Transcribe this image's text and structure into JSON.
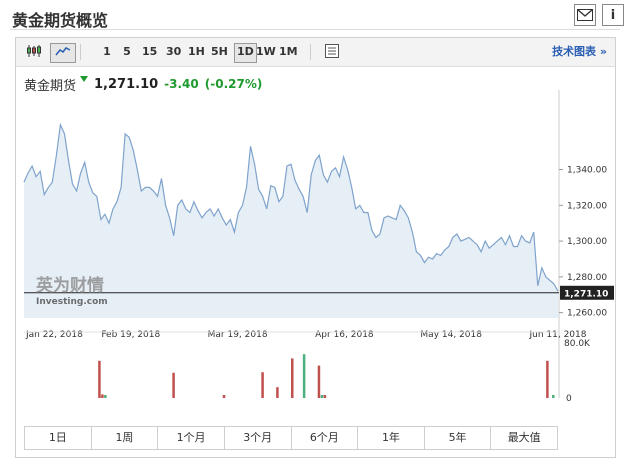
{
  "header": {
    "title": "黄金期货概览",
    "icons": [
      "mail-icon",
      "info-icon"
    ]
  },
  "toolbar": {
    "intervals": [
      "1",
      "5",
      "15",
      "30",
      "1H",
      "5H",
      "1D",
      "1W",
      "1M"
    ],
    "active_interval": "1D",
    "link_label": "技术图表 »"
  },
  "quote": {
    "name": "黄金期货",
    "price": "1,271.10",
    "change": "-3.40",
    "change_pct": "(-0.27%)",
    "direction": "down",
    "down_color": "#1f9a2f"
  },
  "watermark": {
    "line1": "英为财情",
    "line2": "Investing.com"
  },
  "chart_data": {
    "type": "area",
    "y_ticks": [
      "1,340.00",
      "1,320.00",
      "1,300.00",
      "1,280.00",
      "1,260.00"
    ],
    "y_tick_values": [
      1340,
      1320,
      1300,
      1280,
      1260
    ],
    "ylim": [
      1257,
      1380
    ],
    "x_ticks": [
      "Jan 22, 2018",
      "Feb 19, 2018",
      "Mar 19, 2018",
      "Apr 16, 2018",
      "May 14, 2018",
      "Jun 11, 2018"
    ],
    "x_tick_index": [
      0,
      20,
      40,
      60,
      80,
      100
    ],
    "current_label": "1,271.10",
    "current_value": 1271.1,
    "line_color": "#7fa3cc",
    "fill_color": "#e6eef6",
    "values": [
      1333,
      1338,
      1342,
      1336,
      1339,
      1326,
      1330,
      1333,
      1348,
      1365,
      1360,
      1345,
      1332,
      1328,
      1338,
      1344,
      1333,
      1327,
      1325,
      1312,
      1315,
      1310,
      1318,
      1322,
      1330,
      1360,
      1358,
      1351,
      1340,
      1328,
      1330,
      1330,
      1328,
      1325,
      1335,
      1320,
      1313,
      1303,
      1320,
      1323,
      1318,
      1316,
      1322,
      1317,
      1313,
      1316,
      1318,
      1314,
      1318,
      1313,
      1309,
      1312,
      1305,
      1316,
      1320,
      1330,
      1353,
      1343,
      1329,
      1325,
      1318,
      1331,
      1330,
      1322,
      1325,
      1342,
      1343,
      1334,
      1329,
      1325,
      1316,
      1337,
      1345,
      1348,
      1337,
      1333,
      1339,
      1341,
      1336,
      1347,
      1340,
      1330,
      1318,
      1320,
      1316,
      1316,
      1306,
      1302,
      1304,
      1313,
      1314,
      1313,
      1312,
      1320,
      1317,
      1313,
      1305,
      1294,
      1292,
      1288,
      1291,
      1290,
      1293,
      1292,
      1295,
      1297,
      1302,
      1304,
      1300,
      1301,
      1302,
      1300,
      1298,
      1294,
      1300,
      1296,
      1298,
      1300,
      1302,
      1298,
      1303,
      1297,
      1297,
      1303,
      1300,
      1299,
      1305,
      1275,
      1285,
      1280,
      1278,
      1276,
      1272
    ],
    "volume_scale": [
      "80.0K",
      "0"
    ],
    "volume": [
      {
        "i": 25,
        "v": 0.62,
        "color": "#c0504d"
      },
      {
        "i": 26,
        "v": 0.06,
        "color": "#c0504d"
      },
      {
        "i": 27,
        "v": 0.05,
        "color": "#4caf7d"
      },
      {
        "i": 50,
        "v": 0.42,
        "color": "#c0504d"
      },
      {
        "i": 67,
        "v": 0.05,
        "color": "#c0504d"
      },
      {
        "i": 80,
        "v": 0.43,
        "color": "#c0504d"
      },
      {
        "i": 85,
        "v": 0.18,
        "color": "#c0504d"
      },
      {
        "i": 90,
        "v": 0.66,
        "color": "#c0504d"
      },
      {
        "i": 94,
        "v": 0.73,
        "color": "#4caf7d"
      },
      {
        "i": 99,
        "v": 0.54,
        "color": "#c0504d"
      },
      {
        "i": 100,
        "v": 0.05,
        "color": "#4caf7d"
      },
      {
        "i": 101,
        "v": 0.05,
        "color": "#c0504d"
      },
      {
        "i": 176,
        "v": 0.62,
        "color": "#c0504d"
      },
      {
        "i": 178,
        "v": 0.05,
        "color": "#4caf7d"
      }
    ]
  },
  "range_buttons": [
    "1日",
    "1周",
    "1个月",
    "3个月",
    "6个月",
    "1年",
    "5年",
    "最大值"
  ]
}
